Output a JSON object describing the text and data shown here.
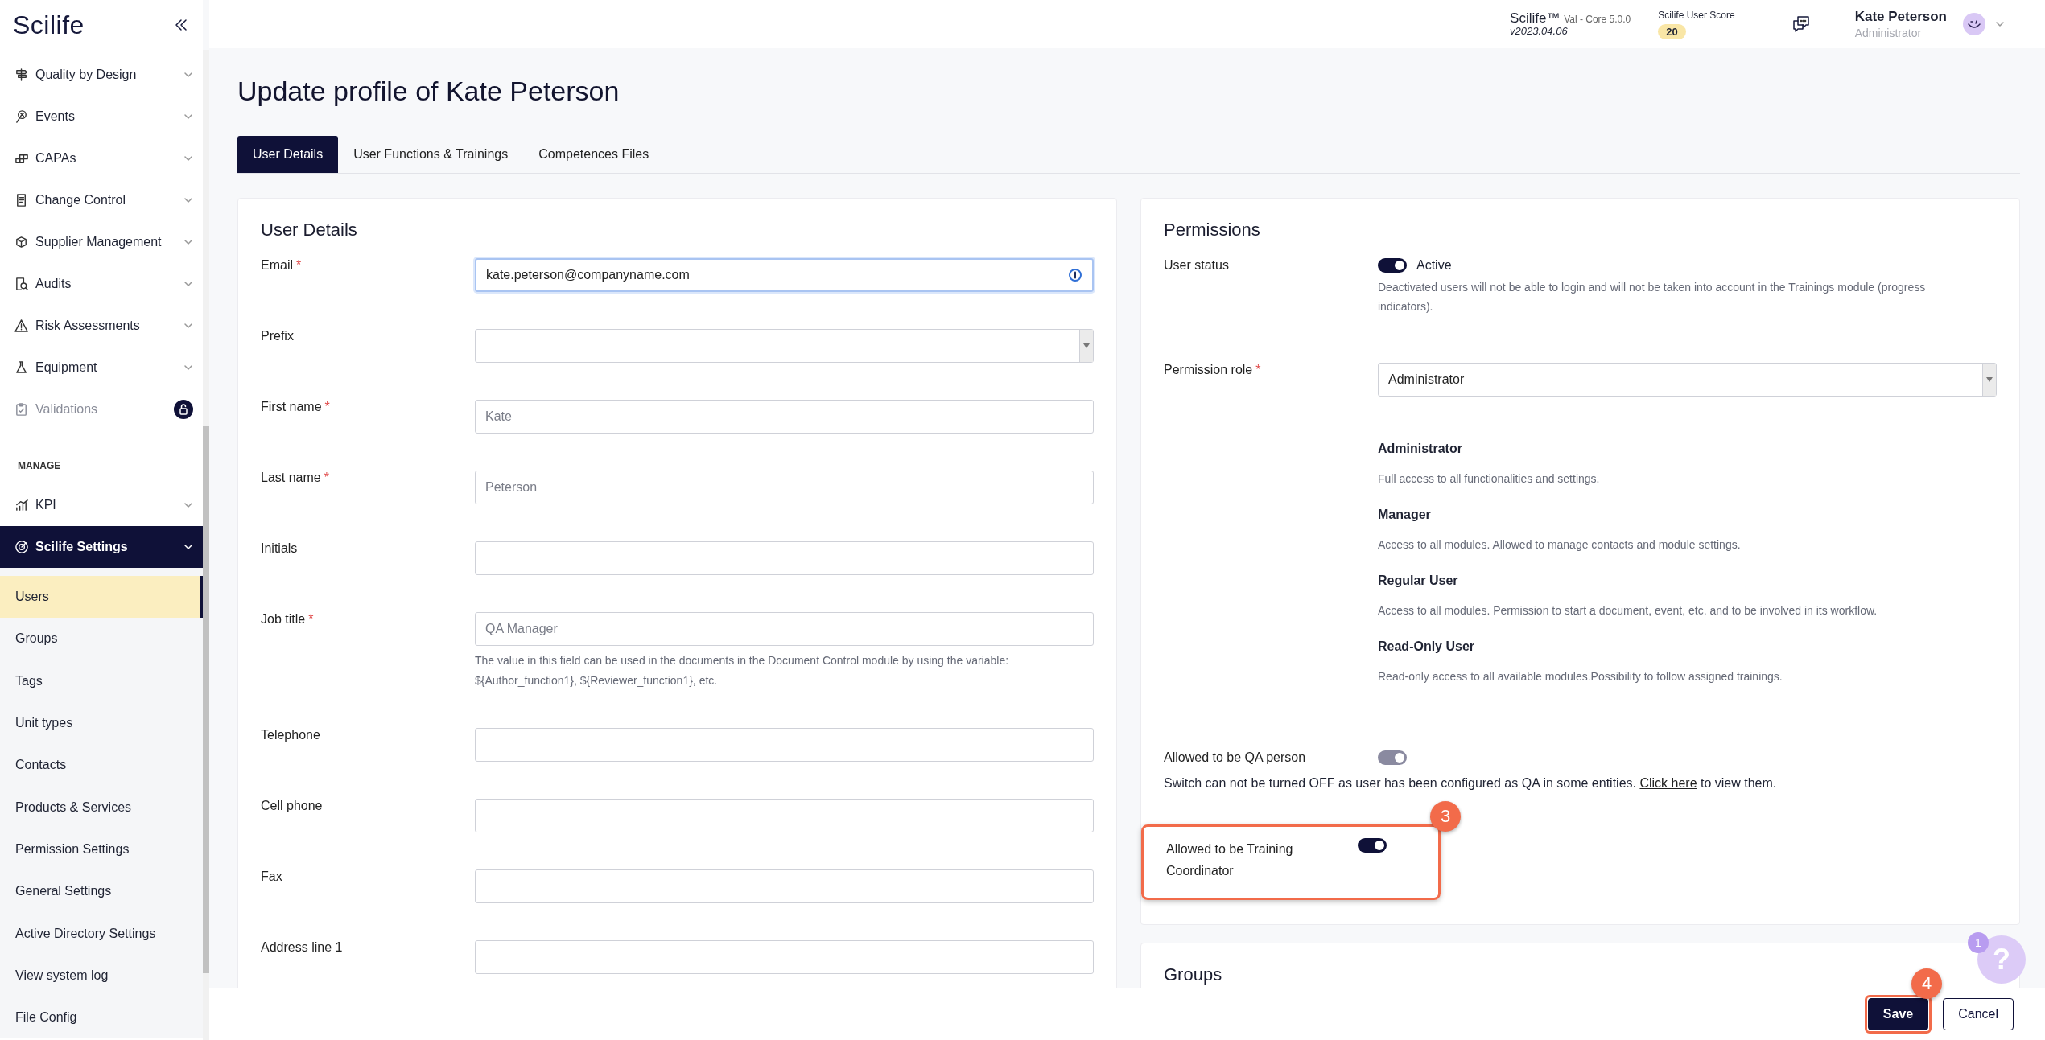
{
  "sidebar": {
    "logo": "Scilife",
    "modules": [
      {
        "label": "Quality by Design",
        "disabled": false,
        "locked": false
      },
      {
        "label": "Events",
        "disabled": false,
        "locked": false
      },
      {
        "label": "CAPAs",
        "disabled": false,
        "locked": false
      },
      {
        "label": "Change Control",
        "disabled": false,
        "locked": false
      },
      {
        "label": "Supplier Management",
        "disabled": false,
        "locked": false
      },
      {
        "label": "Audits",
        "disabled": false,
        "locked": false
      },
      {
        "label": "Risk Assessments",
        "disabled": false,
        "locked": false
      },
      {
        "label": "Equipment",
        "disabled": false,
        "locked": false
      },
      {
        "label": "Validations",
        "disabled": true,
        "locked": true
      }
    ],
    "section_label": "MANAGE",
    "groups": [
      {
        "label": "KPI",
        "selected": false
      },
      {
        "label": "Scilife Settings",
        "selected": true,
        "children": [
          {
            "label": "Users",
            "selected": true
          },
          {
            "label": "Groups",
            "selected": false
          },
          {
            "label": "Tags",
            "selected": false
          },
          {
            "label": "Unit types",
            "selected": false
          },
          {
            "label": "Contacts",
            "selected": false
          },
          {
            "label": "Products & Services",
            "selected": false
          },
          {
            "label": "Permission Settings",
            "selected": false
          },
          {
            "label": "General Settings",
            "selected": false
          },
          {
            "label": "Active Directory Settings",
            "selected": false
          },
          {
            "label": "View system log",
            "selected": false
          },
          {
            "label": "File Config",
            "selected": false
          }
        ]
      }
    ]
  },
  "header": {
    "product": "Scilife™",
    "edition": "Val - Core 5.0.0",
    "version": "v2023.04.06",
    "score_label": "Scilife User Score",
    "score": "20",
    "user_name": "Kate Peterson",
    "user_role": "Administrator"
  },
  "page_title": "Update profile of Kate Peterson",
  "tabs": [
    {
      "label": "User Details",
      "selected": true
    },
    {
      "label": "User Functions & Trainings",
      "selected": false
    },
    {
      "label": "Competences Files",
      "selected": false
    }
  ],
  "user_details": {
    "title": "User Details",
    "fields": [
      {
        "label": "Email",
        "required_mark": "*",
        "kind": "text",
        "value": "kate.peterson@companyname.com",
        "focused": true
      },
      {
        "label": "Prefix",
        "kind": "select",
        "focused": false
      },
      {
        "label": "First name",
        "required_mark": "*",
        "kind": "text",
        "placeholder": "Kate",
        "focused": false
      },
      {
        "label": "Last name",
        "required_mark": "*",
        "kind": "text",
        "placeholder": "Peterson",
        "focused": false
      },
      {
        "label": "Initials",
        "kind": "text",
        "focused": false
      },
      {
        "label": "Job title",
        "required_mark": "*",
        "kind": "text",
        "placeholder": "QA Manager",
        "focused": false,
        "hint": "The value in this field can be used in the documents in the Document Control module by using the variable: ${Author_function1}, ${Reviewer_function1}, etc."
      },
      {
        "label": "Telephone",
        "kind": "text",
        "focused": false
      },
      {
        "label": "Cell phone",
        "kind": "text",
        "focused": false
      },
      {
        "label": "Fax",
        "kind": "text",
        "focused": false
      },
      {
        "label": "Address line 1",
        "kind": "text",
        "focused": false
      }
    ]
  },
  "permissions": {
    "title": "Permissions",
    "user_status": {
      "label": "User status",
      "on": true,
      "disabled": false,
      "state_label": "Active",
      "hint": "Deactivated users will not be able to login and will not be taken into account in the Trainings module (progress indicators)."
    },
    "role": {
      "label": "Permission role",
      "required_mark": "*",
      "value": "Administrator"
    },
    "role_descriptions": [
      {
        "name": "Administrator",
        "description": "Full access to all functionalities and settings."
      },
      {
        "name": "Manager",
        "description": "Access to all modules. Allowed to manage contacts and module settings."
      },
      {
        "name": "Regular User",
        "description": "Access to all modules. Permission to start a document, event, etc. and to be involved in its workflow."
      },
      {
        "name": "Read-Only User",
        "description": "Read-only access to all available modules.Possibility to follow assigned trainings."
      }
    ],
    "qa_person": {
      "label": "Allowed to be QA person",
      "on": true,
      "disabled": true,
      "note_before": "Switch can not be turned OFF as user has been configured as QA in some entities.",
      "note_link": "Click here",
      "note_after": "to view them."
    },
    "training_coordinator": {
      "label": "Allowed to be Training Coordinator",
      "on": true,
      "disabled": false,
      "highlighted": true,
      "step": "3"
    }
  },
  "groups": {
    "title": "Groups"
  },
  "help": {
    "glyph": "?",
    "badge": "1"
  },
  "footer": {
    "buttons": [
      {
        "label": "Save",
        "kind": "primary",
        "highlighted": true,
        "step": "4"
      },
      {
        "label": "Cancel",
        "kind": "secondary",
        "highlighted": false
      }
    ]
  }
}
